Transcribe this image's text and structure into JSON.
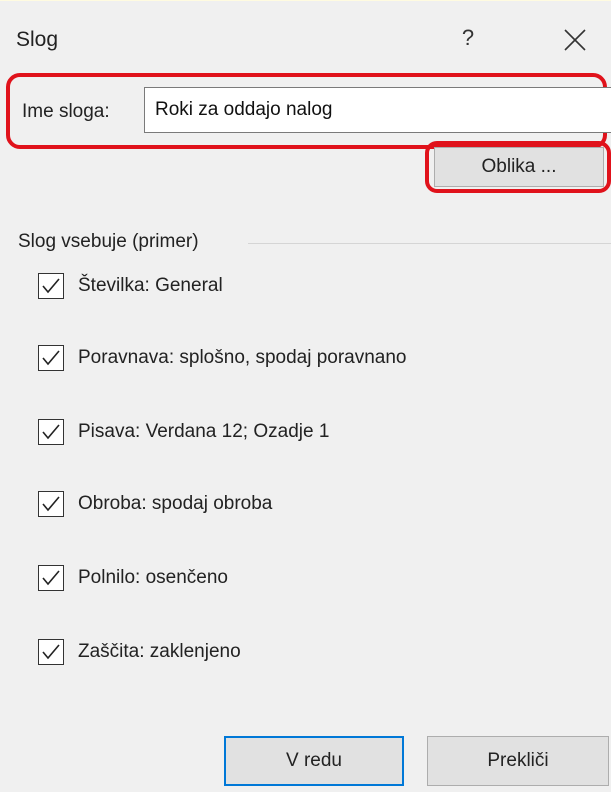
{
  "dialog": {
    "title": "Slog",
    "help_label": "?"
  },
  "name": {
    "label": "Ime sloga:",
    "value": "Roki za oddajo nalog"
  },
  "format_button": "Oblika ...",
  "group": {
    "label": "Slog vsebuje (primer)",
    "items": [
      {
        "label": "Številka: General",
        "checked": true
      },
      {
        "label": "Poravnava: splošno, spodaj poravnano",
        "checked": true
      },
      {
        "label": "Pisava: Verdana 12; Ozadje 1",
        "checked": true
      },
      {
        "label": "Obroba: spodaj obroba",
        "checked": true
      },
      {
        "label": "Polnilo: osenčeno",
        "checked": true
      },
      {
        "label": "Zaščita: zaklenjeno",
        "checked": true
      }
    ]
  },
  "buttons": {
    "ok": "V redu",
    "cancel": "Prekliči"
  },
  "colors": {
    "highlight": "#e0121b",
    "focus_border": "#0078d7",
    "background": "#f0f0f0"
  },
  "icons": [
    "close-icon",
    "help-icon",
    "checkmark-icon"
  ]
}
